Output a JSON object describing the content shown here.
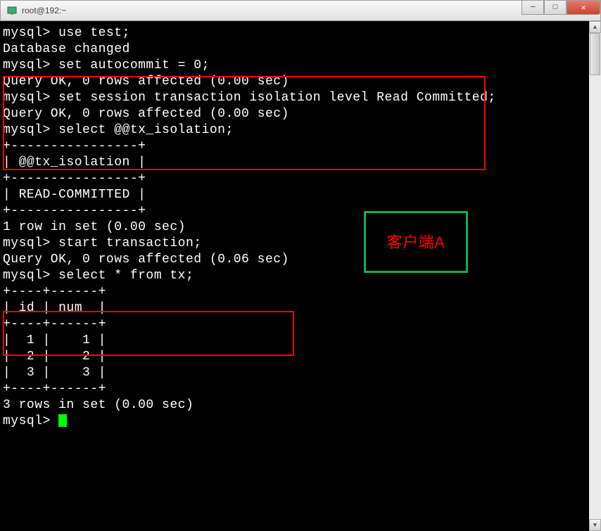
{
  "window": {
    "title": "root@192:~"
  },
  "terminal": {
    "lines": [
      "",
      "mysql> use test;",
      "Database changed",
      "mysql> set autocommit = 0;",
      "Query OK, 0 rows affected (0.00 sec)",
      "",
      "mysql> set session transaction isolation level Read Committed;",
      "Query OK, 0 rows affected (0.00 sec)",
      "",
      "mysql> select @@tx_isolation;",
      "+----------------+",
      "| @@tx_isolation |",
      "+----------------+",
      "| READ-COMMITTED |",
      "+----------------+",
      "1 row in set (0.00 sec)",
      "",
      "mysql> start transaction;",
      "Query OK, 0 rows affected (0.06 sec)",
      "",
      "mysql> select * from tx;",
      "+----+------+",
      "| id | num  |",
      "+----+------+",
      "|  1 |    1 |",
      "|  2 |    2 |",
      "|  3 |    3 |",
      "+----+------+",
      "3 rows in set (0.00 sec)",
      "",
      "mysql> "
    ],
    "cursor_line": 30
  },
  "annotation": {
    "green_box_label": "客户端A"
  },
  "window_controls": {
    "minimize": "─",
    "maximize": "□",
    "close": "✕"
  },
  "scrollbar": {
    "up": "▲",
    "down": "▼"
  }
}
